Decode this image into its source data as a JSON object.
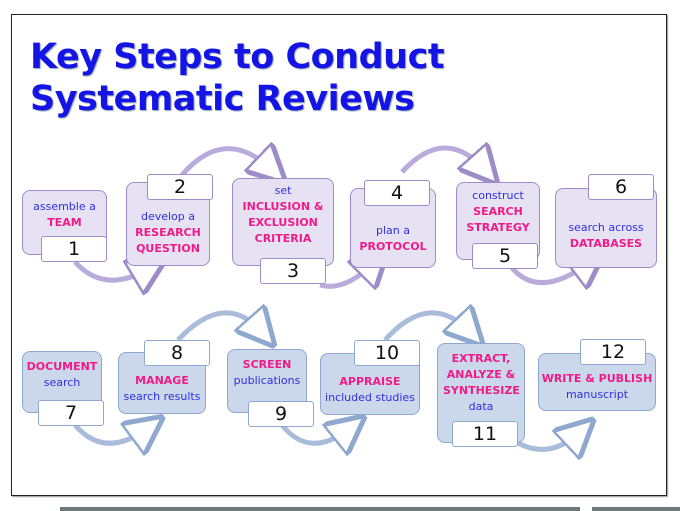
{
  "title": {
    "line1": "Key Steps to Conduct",
    "line2": "Systematic Reviews"
  },
  "steps": [
    {
      "number": "1",
      "pre": "assemble a",
      "key": "TEAM",
      "post": ""
    },
    {
      "number": "2",
      "pre": "develop a",
      "key": "RESEARCH QUESTION",
      "post": ""
    },
    {
      "number": "3",
      "pre": "set",
      "key": "INCLUSION & EXCLUSION CRITERIA",
      "post": ""
    },
    {
      "number": "4",
      "pre": "plan a",
      "key": "PROTOCOL",
      "post": ""
    },
    {
      "number": "5",
      "pre": "construct",
      "key": "SEARCH STRATEGY",
      "post": ""
    },
    {
      "number": "6",
      "pre": "search across",
      "key": "DATABASES",
      "post": ""
    },
    {
      "number": "7",
      "pre": "",
      "key": "DOCUMENT",
      "post": "search"
    },
    {
      "number": "8",
      "pre": "",
      "key": "MANAGE",
      "post": "search results"
    },
    {
      "number": "9",
      "pre": "",
      "key": "SCREEN",
      "post": "publications"
    },
    {
      "number": "10",
      "pre": "",
      "key": "APPRAISE",
      "post": "included studies"
    },
    {
      "number": "11",
      "pre": "",
      "key": "EXTRACT, ANALYZE & SYNTHESIZE",
      "post": "data"
    },
    {
      "number": "12",
      "pre": "",
      "key": "WRITE & PUBLISH",
      "post": "manuscript"
    }
  ],
  "colors": {
    "title": "#1414e6",
    "keyword": "#ef1b86",
    "text": "#3030e0",
    "row1_fill": "#e6e1f3",
    "row2_fill": "#cbd7ea"
  }
}
